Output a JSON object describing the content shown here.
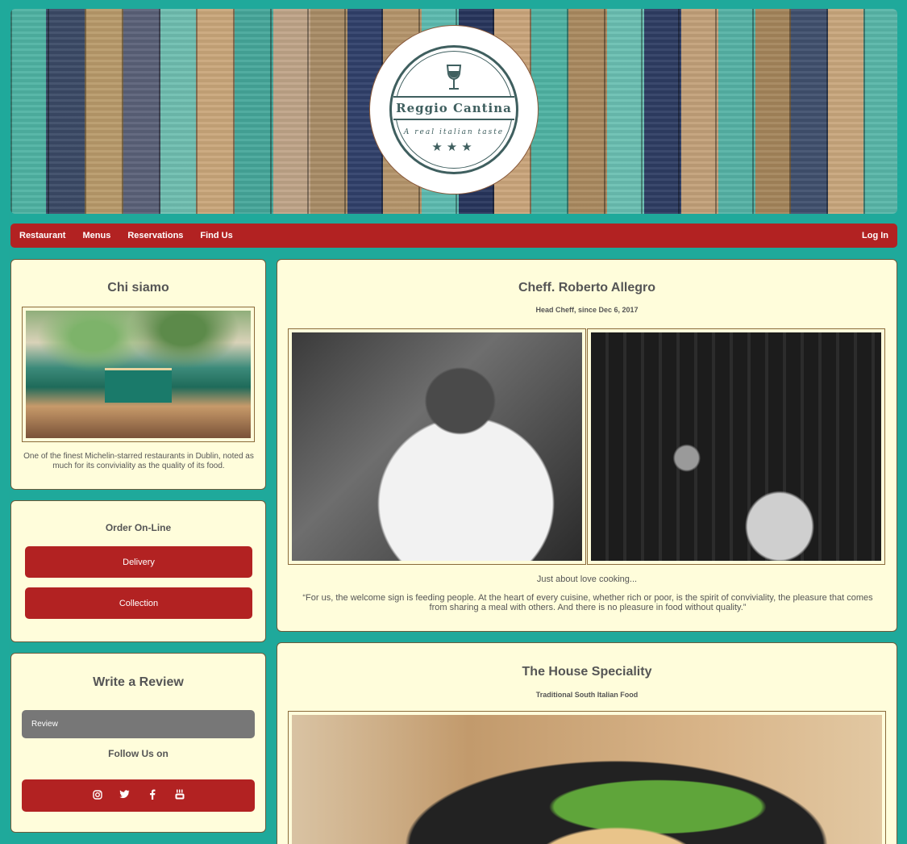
{
  "header": {
    "logo_name": "Reggio Cantina",
    "logo_tagline": "A real italian taste",
    "logo_stars": "★★★"
  },
  "nav": {
    "items": [
      "Restaurant",
      "Menus",
      "Reservations",
      "Find Us"
    ],
    "login": "Log In"
  },
  "about": {
    "title": "Chi siamo",
    "description": "One of the finest Michelin-starred restaurants in Dublin, noted as much for its conviviality as the quality of its food."
  },
  "order": {
    "title": "Order On-Line",
    "delivery_label": "Delivery",
    "collection_label": "Collection"
  },
  "review": {
    "title": "Write a Review",
    "review_label": "Review",
    "follow_title": "Follow Us on",
    "social_icons": [
      "instagram-icon",
      "twitter-icon",
      "facebook-icon",
      "youtube-icon"
    ]
  },
  "chef": {
    "title": "Cheff. Roberto Allegro",
    "subtitle": "Head Cheff, since Dec 6, 2017",
    "caption": "Just about love cooking...",
    "quote": "“For us, the welcome sign is feeding people. At the heart of every cuisine, whether rich or poor, is the spirit of conviviality, the pleasure that comes from sharing a meal with others. And there is no pleasure in food without quality.”"
  },
  "house": {
    "title": "The House Speciality",
    "subtitle": "Traditional South Italian Food"
  },
  "colors": {
    "background": "#1fa99b",
    "accent_red": "#b22222",
    "card_bg": "#fffddb",
    "logo_teal": "#3f5f5f"
  }
}
